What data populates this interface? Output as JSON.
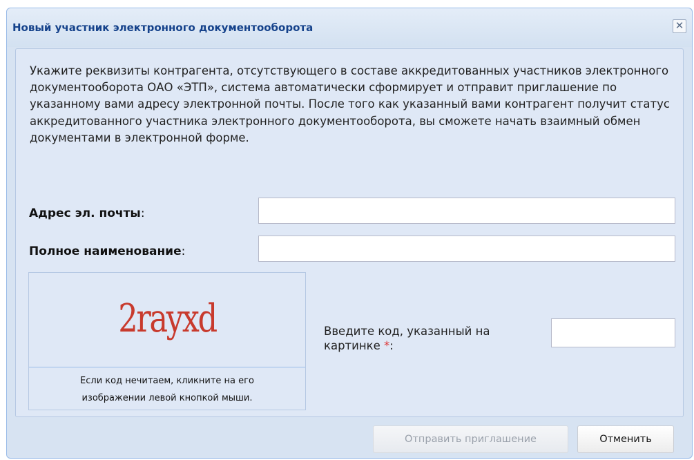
{
  "dialog": {
    "title": "Новый участник электронного документооборота",
    "close_glyph": "✕"
  },
  "description": "Укажите реквизиты контрагента, отсутствующего в составе аккредитованных участников электронного документооборота ОАО «ЭТП», система автоматически сформирует и отправит приглашение по указанному вами адресу электронной почты. После того как указанный вами контрагент получит статус аккредитованного участника электронного документооборота, вы сможете начать взаимный обмен документами в электронной форме.",
  "form": {
    "email_label": "Адрес эл. почты",
    "email_value": "",
    "fullname_label": "Полное наименование",
    "fullname_value": "",
    "label_colon": ":",
    "captcha_text": "2rayxd",
    "captcha_hint_line1": "Если код нечитаем, кликните на его",
    "captcha_hint_line2": "изображении левой кнопкой мыши.",
    "code_label": "Введите код, указанный на картинке",
    "required_mark": "*",
    "code_label_suffix": ":",
    "code_value": ""
  },
  "buttons": {
    "send_label": "Отправить приглашение",
    "send_enabled": false,
    "cancel_label": "Отменить"
  },
  "colors": {
    "title": "#15428b",
    "captcha": "#c83a2d",
    "required": "#dd3333"
  }
}
